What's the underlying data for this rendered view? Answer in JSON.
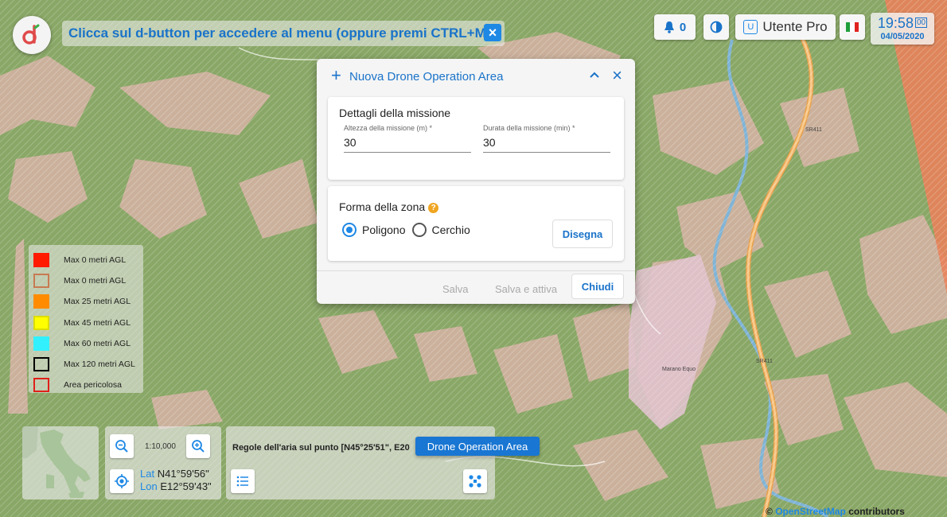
{
  "header": {
    "hint_text": "Clicca sul d-button per accedere al menu (oppure premi CTRL+M).",
    "notifications_count": "0",
    "user_badge": "U",
    "user_name": "Utente Pro",
    "clock_time": "19:58",
    "clock_seconds": "00",
    "clock_date": "04/05/2020"
  },
  "dialog": {
    "title": "Nuova Drone Operation Area",
    "mission_card": {
      "title": "Dettagli della missione",
      "altitude_label": "Altezza della missione (m) *",
      "altitude_value": "30",
      "duration_label": "Durata della missione (min) *",
      "duration_value": "30"
    },
    "shape_card": {
      "title": "Forma della zona",
      "option_polygon": "Poligono",
      "option_circle": "Cerchio",
      "selected": "Poligono",
      "draw_button": "Disegna"
    },
    "footer": {
      "save": "Salva",
      "save_activate": "Salva e attiva",
      "close": "Chiudi"
    }
  },
  "legend": {
    "items": [
      {
        "label": "Max 0 metri AGL",
        "fill": "#ff1a00",
        "border": "#ff1a00"
      },
      {
        "label": "Max 0 metri AGL",
        "fill": "transparent",
        "border": "#c87a52"
      },
      {
        "label": "Max 25 metri AGL",
        "fill": "#ff8c00",
        "border": "#ff8c00"
      },
      {
        "label": "Max 45 metri AGL",
        "fill": "#ffff00",
        "border": "#dddd00"
      },
      {
        "label": "Max 60 metri AGL",
        "fill": "#33f0ff",
        "border": "#33f0ff"
      },
      {
        "label": "Max 120 metri AGL",
        "fill": "transparent",
        "border": "#000000"
      },
      {
        "label": "Area pericolosa",
        "fill": "transparent",
        "border": "#e0201a"
      }
    ]
  },
  "map_controls": {
    "scale": "1:10,000",
    "lat_key": "Lat",
    "lat_value": "N41°59'56\"",
    "lon_key": "Lon",
    "lon_value": "E12°59'43\""
  },
  "rules_panel": {
    "text": "Regole dell'aria sul punto [N45°25'51\", E20",
    "tooltip": "Drone Operation Area"
  },
  "map_labels": {
    "town": "Marano Equo",
    "road1": "SR411",
    "road2": "SR411"
  },
  "attribution": {
    "prefix": "©",
    "link": "OpenStreetMap",
    "suffix": "contributors"
  },
  "colors": {
    "accent": "#1e88e5",
    "restricted_area": "#e8825a"
  }
}
